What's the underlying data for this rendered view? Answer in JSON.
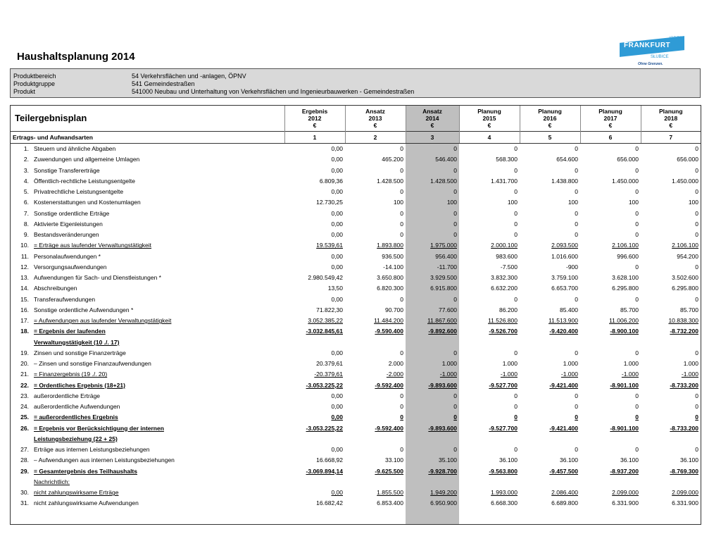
{
  "title": "Haushaltsplanung 2014",
  "logo": {
    "oder": "(ODER)",
    "brand": "FRANKFURT",
    "city2": "SŁUBICE",
    "slogan": "Ohne Grenzen."
  },
  "product": [
    {
      "k": "Produktbereich",
      "v": "54 Verkehrsflächen und -anlagen, ÖPNV"
    },
    {
      "k": "Produktgruppe",
      "v": "541 Gemeindestraßen"
    },
    {
      "k": "Produkt",
      "v": "541000 Neubau und Unterhaltung von Verkehrsflächen und Ingenieurbauwerken - Gemeindestraßen"
    }
  ],
  "table": {
    "heading": "Teilergebnisplan",
    "subheading": "Ertrags- und Aufwandsarten",
    "columns": [
      {
        "l1": "Ergebnis",
        "l2": "2012",
        "l3": "€",
        "n": "1"
      },
      {
        "l1": "Ansatz",
        "l2": "2013",
        "l3": "€",
        "n": "2"
      },
      {
        "l1": "Ansatz",
        "l2": "2014",
        "l3": "€",
        "n": "3"
      },
      {
        "l1": "Planung",
        "l2": "2015",
        "l3": "€",
        "n": "4"
      },
      {
        "l1": "Planung",
        "l2": "2016",
        "l3": "€",
        "n": "5"
      },
      {
        "l1": "Planung",
        "l2": "2017",
        "l3": "€",
        "n": "6"
      },
      {
        "l1": "Planung",
        "l2": "2018",
        "l3": "€",
        "n": "7"
      }
    ],
    "rows": [
      {
        "no": "1.",
        "label": "Steuern und ähnliche Abgaben",
        "v": [
          "0,00",
          "0",
          "0",
          "0",
          "0",
          "0",
          "0"
        ]
      },
      {
        "no": "2.",
        "label": "Zuwendungen und allgemeine Umlagen",
        "v": [
          "0,00",
          "465.200",
          "546.400",
          "568.300",
          "654.600",
          "656.000",
          "656.000"
        ]
      },
      {
        "no": "3.",
        "label": "Sonstige Transfererträge",
        "v": [
          "0,00",
          "0",
          "0",
          "0",
          "0",
          "0",
          "0"
        ]
      },
      {
        "no": "4.",
        "label": "Öffentlich-rechtliche Leistungsentgelte",
        "v": [
          "6.809,36",
          "1.428.500",
          "1.428.500",
          "1.431.700",
          "1.438.800",
          "1.450.000",
          "1.450.000"
        ]
      },
      {
        "no": "5.",
        "label": "Privatrechtliche Leistungsentgelte",
        "v": [
          "0,00",
          "0",
          "0",
          "0",
          "0",
          "0",
          "0"
        ]
      },
      {
        "no": "6.",
        "label": "Kostenerstattungen und Kostenumlagen",
        "v": [
          "12.730,25",
          "100",
          "100",
          "100",
          "100",
          "100",
          "100"
        ]
      },
      {
        "no": "7.",
        "label": "Sonstige ordentliche Erträge",
        "v": [
          "0,00",
          "0",
          "0",
          "0",
          "0",
          "0",
          "0"
        ]
      },
      {
        "no": "8.",
        "label": "Aktivierte Eigenleistungen",
        "v": [
          "0,00",
          "0",
          "0",
          "0",
          "0",
          "0",
          "0"
        ]
      },
      {
        "no": "9.",
        "label": "Bestandsveränderungen",
        "v": [
          "0,00",
          "0",
          "0",
          "0",
          "0",
          "0",
          "0"
        ]
      },
      {
        "no": "10.",
        "label": "= Erträge aus laufender Verwaltungstätigkeit",
        "v": [
          "19.539,61",
          "1.893.800",
          "1.975.000",
          "2.000.100",
          "2.093.500",
          "2.106.100",
          "2.106.100"
        ],
        "ul": true
      },
      {
        "no": "11.",
        "label": "Personalaufwendungen *",
        "v": [
          "0,00",
          "936.500",
          "956.400",
          "983.600",
          "1.016.600",
          "996.600",
          "954.200"
        ]
      },
      {
        "no": "12.",
        "label": "Versorgungsaufwendungen",
        "v": [
          "0,00",
          "-14.100",
          "-11.700",
          "-7.500",
          "-900",
          "0",
          "0"
        ]
      },
      {
        "no": "13.",
        "label": "Aufwendungen für Sach- und Dienstleistungen *",
        "v": [
          "2.980.549,42",
          "3.650.800",
          "3.929.500",
          "3.832.300",
          "3.759.100",
          "3.628.100",
          "3.502.600"
        ]
      },
      {
        "no": "14.",
        "label": "Abschreibungen",
        "v": [
          "13,50",
          "6.820.300",
          "6.915.800",
          "6.632.200",
          "6.653.700",
          "6.295.800",
          "6.295.800"
        ]
      },
      {
        "no": "15.",
        "label": "Transferaufwendungen",
        "v": [
          "0,00",
          "0",
          "0",
          "0",
          "0",
          "0",
          "0"
        ]
      },
      {
        "no": "16.",
        "label": "Sonstige ordentliche Aufwendungen *",
        "v": [
          "71.822,30",
          "90.700",
          "77.600",
          "86.200",
          "85.400",
          "85.700",
          "85.700"
        ]
      },
      {
        "no": "17.",
        "label": "= Aufwendungen aus laufender Verwaltungstätigkeit",
        "v": [
          "3.052.385,22",
          "11.484.200",
          "11.867.600",
          "11.526.800",
          "11.513.900",
          "11.006.200",
          "10.838.300"
        ],
        "ul": true
      },
      {
        "no": "18.",
        "label": "= Ergebnis der laufenden",
        "v": [
          "-3.032.845,61",
          "-9.590.400",
          "-9.892.600",
          "-9.526.700",
          "-9.420.400",
          "-8.900.100",
          "-8.732.200"
        ],
        "ul": true,
        "bold": true
      },
      {
        "no": "",
        "label": "Verwaltungstätigkeit (10 ./. 17)",
        "v": [
          "",
          "",
          "",
          "",
          "",
          "",
          ""
        ],
        "ul": true,
        "bold": true
      },
      {
        "no": "19.",
        "label": "Zinsen und sonstige Finanzerträge",
        "v": [
          "0,00",
          "0",
          "0",
          "0",
          "0",
          "0",
          "0"
        ]
      },
      {
        "no": "20.",
        "label": "– Zinsen und sonstige Finanzaufwendungen",
        "v": [
          "20.379,61",
          "2.000",
          "1.000",
          "1.000",
          "1.000",
          "1.000",
          "1.000"
        ]
      },
      {
        "no": "21.",
        "label": "= Finanzergebnis (19 ./. 20)",
        "v": [
          "-20.379,61",
          "-2.000",
          "-1.000",
          "-1.000",
          "-1.000",
          "-1.000",
          "-1.000"
        ],
        "ul": true
      },
      {
        "no": "22.",
        "label": "= Ordentliches Ergebnis (18+21)",
        "v": [
          "-3.053.225,22",
          "-9.592.400",
          "-9.893.600",
          "-9.527.700",
          "-9.421.400",
          "-8.901.100",
          "-8.733.200"
        ],
        "ul": true,
        "bold": true
      },
      {
        "no": "23.",
        "label": "außerordentliche Erträge",
        "v": [
          "0,00",
          "0",
          "0",
          "0",
          "0",
          "0",
          "0"
        ]
      },
      {
        "no": "24.",
        "label": "außerordentliche Aufwendungen",
        "v": [
          "0,00",
          "0",
          "0",
          "0",
          "0",
          "0",
          "0"
        ]
      },
      {
        "no": "25.",
        "label": "= außerordentliches Ergebnis",
        "v": [
          "0,00",
          "0",
          "0",
          "0",
          "0",
          "0",
          "0"
        ],
        "ul": true,
        "bold": true
      },
      {
        "no": "26.",
        "label": "= Ergebnis vor Berücksichtigung der internen",
        "v": [
          "-3.053.225,22",
          "-9.592.400",
          "-9.893.600",
          "-9.527.700",
          "-9.421.400",
          "-8.901.100",
          "-8.733.200"
        ],
        "ul": true,
        "bold": true
      },
      {
        "no": "",
        "label": "Leistungsbeziehung (22 + 25)",
        "v": [
          "",
          "",
          "",
          "",
          "",
          "",
          ""
        ],
        "ul": true,
        "bold": true
      },
      {
        "no": "27.",
        "label": "Erträge aus internen Leistungsbeziehungen",
        "v": [
          "0,00",
          "0",
          "0",
          "0",
          "0",
          "0",
          "0"
        ]
      },
      {
        "no": "28.",
        "label": "– Aufwendungen aus internen Leistungsbeziehungen",
        "v": [
          "16.668,92",
          "33.100",
          "35.100",
          "36.100",
          "36.100",
          "36.100",
          "36.100"
        ]
      },
      {
        "no": "29.",
        "label": "= Gesamtergebnis des Teilhaushalts",
        "v": [
          "-3.069.894,14",
          "-9.625.500",
          "-9.928.700",
          "-9.563.800",
          "-9.457.500",
          "-8.937.200",
          "-8.769.300"
        ],
        "ul": true,
        "bold": true
      },
      {
        "no": "",
        "label": "Nachrichtlich:",
        "v": [
          "",
          "",
          "",
          "",
          "",
          "",
          ""
        ],
        "ul": true
      },
      {
        "no": "30.",
        "label": "nicht zahlungswirksame Erträge",
        "v": [
          "0,00",
          "1.855.500",
          "1.949.200",
          "1.993.000",
          "2.086.400",
          "2.099.000",
          "2.099.000"
        ],
        "ul": true
      },
      {
        "no": "31.",
        "label": "nicht zahlungswirksame Aufwendungen",
        "v": [
          "16.682,42",
          "6.853.400",
          "6.950.900",
          "6.668.300",
          "6.689.800",
          "6.331.900",
          "6.331.900"
        ]
      }
    ]
  }
}
